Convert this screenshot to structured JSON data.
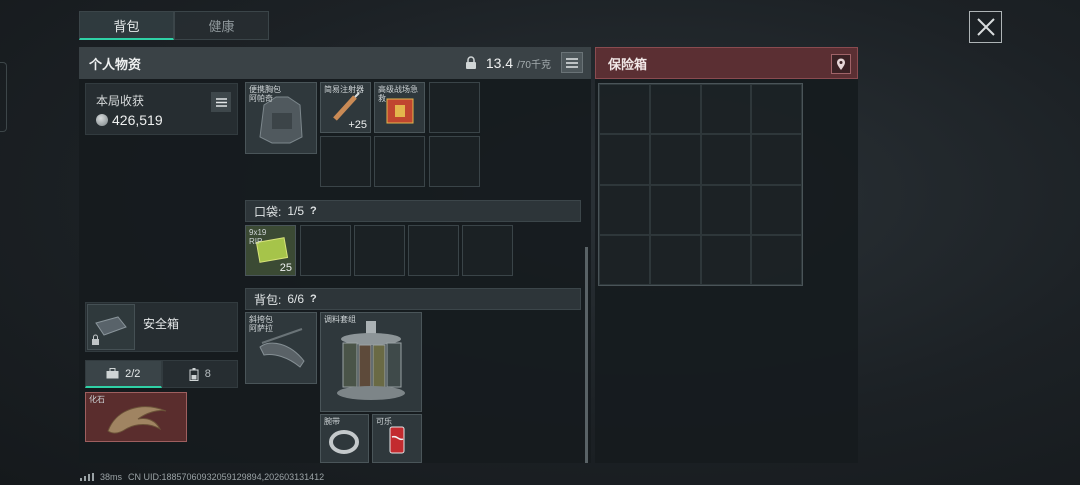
{
  "tabs": [
    {
      "label": "背包",
      "active": true
    },
    {
      "label": "健康",
      "active": false
    }
  ],
  "personal": {
    "title": "个人物资",
    "weight_current": "13.4",
    "weight_max": "/70千克"
  },
  "income": {
    "label": "本局收获",
    "value": "426,519"
  },
  "rig_items": [
    {
      "name": "便携胸包 阿帕奇"
    },
    {
      "name": "简易注射器",
      "qty": "+25"
    },
    {
      "name": "高级战场急救"
    }
  ],
  "pocket": {
    "label": "口袋:",
    "count": "1/5",
    "help": "?"
  },
  "pocket_items": [
    {
      "name": "9x19 RIP",
      "qty": "25"
    }
  ],
  "backpack": {
    "label": "背包:",
    "count": "6/6",
    "help": "?"
  },
  "backpack_items": [
    {
      "name": "斜挎包 阿萨拉"
    },
    {
      "name": "调料套组"
    },
    {
      "name": "腕带"
    },
    {
      "name": "可乐"
    }
  ],
  "safebox": {
    "label": "安全箱"
  },
  "subtabs": [
    {
      "label": "2/2",
      "icon": "toolbox-icon",
      "active": true
    },
    {
      "label": "8",
      "icon": "battery-icon",
      "active": false
    }
  ],
  "fossil": {
    "name": "化石"
  },
  "safe_panel": {
    "title": "保险箱"
  },
  "status": {
    "signal": "38ms",
    "uid": "CN UID:18857060932059129894,202603131412"
  },
  "colors": {
    "accent": "#2fd1a6",
    "safe_header": "#5b2f33",
    "fossil_bg": "#5a2d2d"
  }
}
